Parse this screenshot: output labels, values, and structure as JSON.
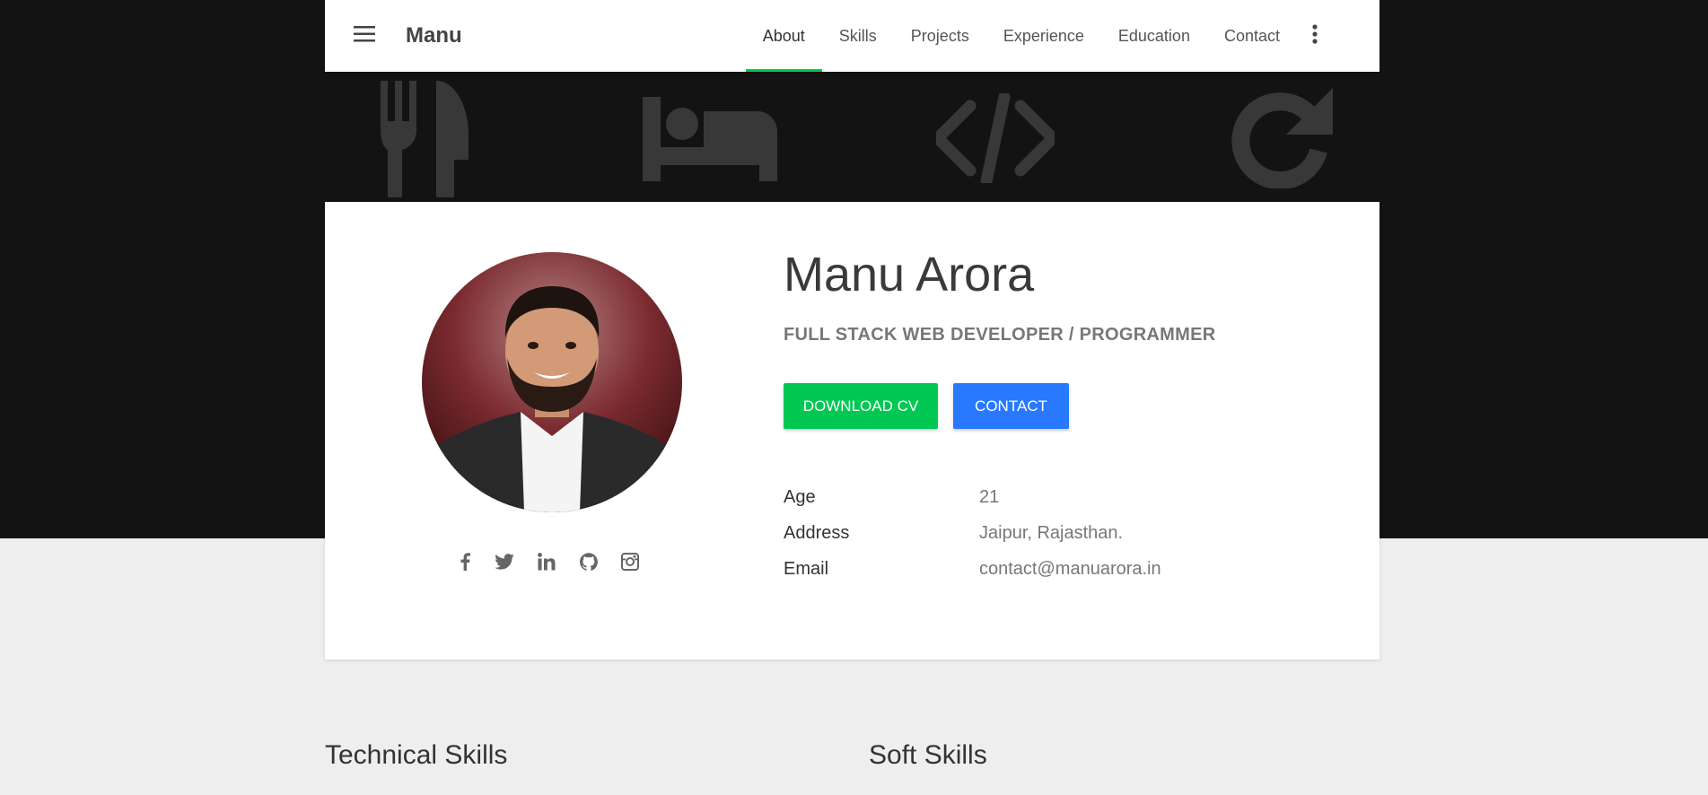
{
  "nav": {
    "brand": "Manu",
    "links": [
      "About",
      "Skills",
      "Projects",
      "Experience",
      "Education",
      "Contact"
    ],
    "active_link": "About",
    "accent_color": "#00c853"
  },
  "hero": {
    "background_color": "#131313",
    "icons": [
      "fork-knife-icon",
      "bed-icon",
      "code-icon",
      "refresh-icon"
    ]
  },
  "profile": {
    "name": "Manu Arora",
    "role": "FULL STACK WEB DEVELOPER / PROGRAMMER",
    "buttons": {
      "download_cv": "DOWNLOAD CV",
      "contact": "CONTACT"
    },
    "button_colors": {
      "download_cv": "#00c853",
      "contact": "#2979ff"
    },
    "info": [
      {
        "label": "Age",
        "value": "21"
      },
      {
        "label": "Address",
        "value": "Jaipur, Rajasthan."
      },
      {
        "label": "Email",
        "value": "contact@manuarora.in"
      }
    ],
    "social": [
      "facebook-icon",
      "twitter-icon",
      "linkedin-icon",
      "github-icon",
      "instagram-icon"
    ]
  },
  "sections": {
    "technical_skills": "Technical Skills",
    "soft_skills": "Soft Skills"
  }
}
